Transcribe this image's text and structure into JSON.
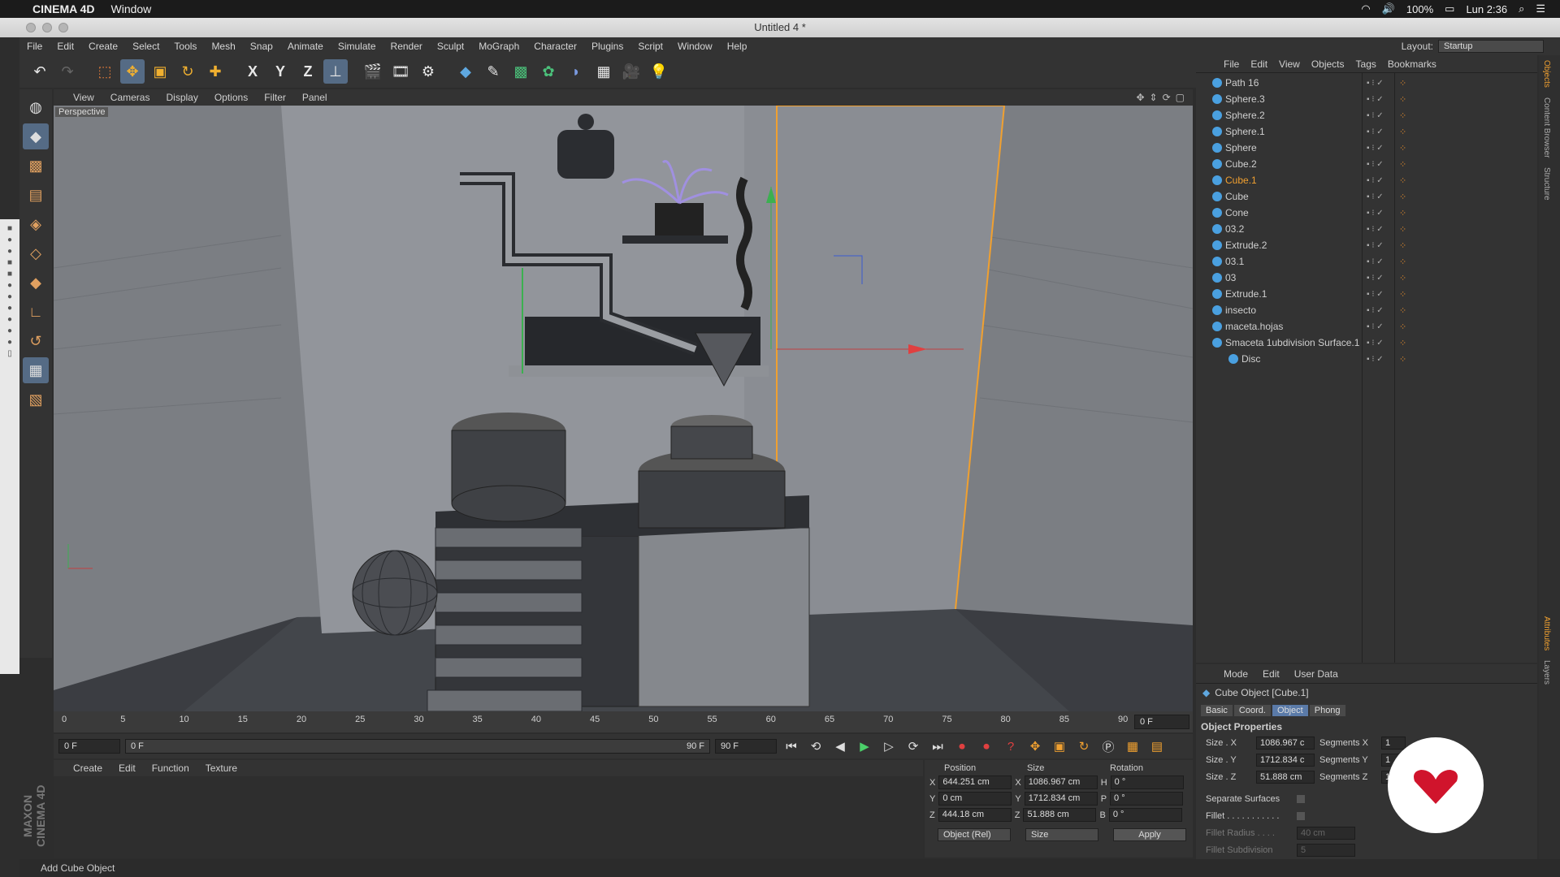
{
  "mac": {
    "app": "CINEMA 4D",
    "menu": "Window",
    "battery": "100%",
    "clock": "Lun 2:36"
  },
  "window": {
    "title": "Untitled 4 *"
  },
  "menu": {
    "items": [
      "File",
      "Edit",
      "Create",
      "Select",
      "Tools",
      "Mesh",
      "Snap",
      "Animate",
      "Simulate",
      "Render",
      "Sculpt",
      "MoGraph",
      "Character",
      "Plugins",
      "Script",
      "Window",
      "Help"
    ],
    "layout_label": "Layout:",
    "layout_value": "Startup"
  },
  "toolbar": {
    "axis_x": "X",
    "axis_y": "Y",
    "axis_z": "Z"
  },
  "viewport": {
    "menu": [
      "View",
      "Cameras",
      "Display",
      "Options",
      "Filter",
      "Panel"
    ],
    "label": "Perspective"
  },
  "timeline": {
    "ticks": [
      "0",
      "5",
      "10",
      "15",
      "20",
      "25",
      "30",
      "35",
      "40",
      "45",
      "50",
      "55",
      "60",
      "65",
      "70",
      "75",
      "80",
      "85",
      "90"
    ],
    "current": "0 F"
  },
  "transport": {
    "start": "0 F",
    "range_start": "0 F",
    "range_end": "90 F",
    "end": "90 F"
  },
  "material": {
    "menu": [
      "Create",
      "Edit",
      "Function",
      "Texture"
    ]
  },
  "coords": {
    "headers": [
      "Position",
      "Size",
      "Rotation"
    ],
    "rows": [
      {
        "axis": "X",
        "pos": "644.251 cm",
        "saxis": "X",
        "size": "1086.967 cm",
        "raxis": "H",
        "rot": "0 °"
      },
      {
        "axis": "Y",
        "pos": "0 cm",
        "saxis": "Y",
        "size": "1712.834 cm",
        "raxis": "P",
        "rot": "0 °"
      },
      {
        "axis": "Z",
        "pos": "444.18 cm",
        "saxis": "Z",
        "size": "51.888 cm",
        "raxis": "B",
        "rot": "0 °"
      }
    ],
    "mode": "Object (Rel)",
    "size_mode": "Size",
    "apply": "Apply"
  },
  "objects": {
    "menu": [
      "File",
      "Edit",
      "View",
      "Objects",
      "Tags",
      "Bookmarks"
    ],
    "items": [
      {
        "name": "Path 16",
        "sel": false
      },
      {
        "name": "Sphere.3",
        "sel": false
      },
      {
        "name": "Sphere.2",
        "sel": false
      },
      {
        "name": "Sphere.1",
        "sel": false
      },
      {
        "name": "Sphere",
        "sel": false
      },
      {
        "name": "Cube.2",
        "sel": false
      },
      {
        "name": "Cube.1",
        "sel": true
      },
      {
        "name": "Cube",
        "sel": false
      },
      {
        "name": "Cone",
        "sel": false
      },
      {
        "name": "03.2",
        "sel": false
      },
      {
        "name": "Extrude.2",
        "sel": false
      },
      {
        "name": "03.1",
        "sel": false
      },
      {
        "name": "03",
        "sel": false
      },
      {
        "name": "Extrude.1",
        "sel": false
      },
      {
        "name": "insecto",
        "sel": false
      },
      {
        "name": "maceta.hojas",
        "sel": false
      },
      {
        "name": "Smaceta 1ubdivision Surface.1",
        "sel": false
      },
      {
        "name": "Disc",
        "sel": false
      }
    ]
  },
  "attributes": {
    "menu": [
      "Mode",
      "Edit",
      "User Data"
    ],
    "object_title": "Cube Object [Cube.1]",
    "tabs": [
      "Basic",
      "Coord.",
      "Object",
      "Phong"
    ],
    "section": "Object Properties",
    "size_x_label": "Size . X",
    "size_x": "1086.967 c",
    "seg_x_label": "Segments X",
    "seg_x": "1",
    "size_y_label": "Size . Y",
    "size_y": "1712.834 c",
    "seg_y_label": "Segments Y",
    "seg_y": "1",
    "size_z_label": "Size . Z",
    "size_z": "51.888 cm",
    "seg_z_label": "Segments Z",
    "seg_z": "1",
    "separate": "Separate Surfaces",
    "fillet": "Fillet . . . . . . . . . . .",
    "fillet_radius_label": "Fillet Radius . . . .",
    "fillet_radius": "40 cm",
    "fillet_sub_label": "Fillet Subdivision",
    "fillet_sub": "5"
  },
  "status": {
    "text": "Add Cube Object"
  },
  "rightstrip": {
    "tabs": [
      "Objects",
      "Content Browser",
      "Structure",
      "Attributes",
      "Layers"
    ]
  },
  "maxon": "MAXON CINEMA 4D"
}
